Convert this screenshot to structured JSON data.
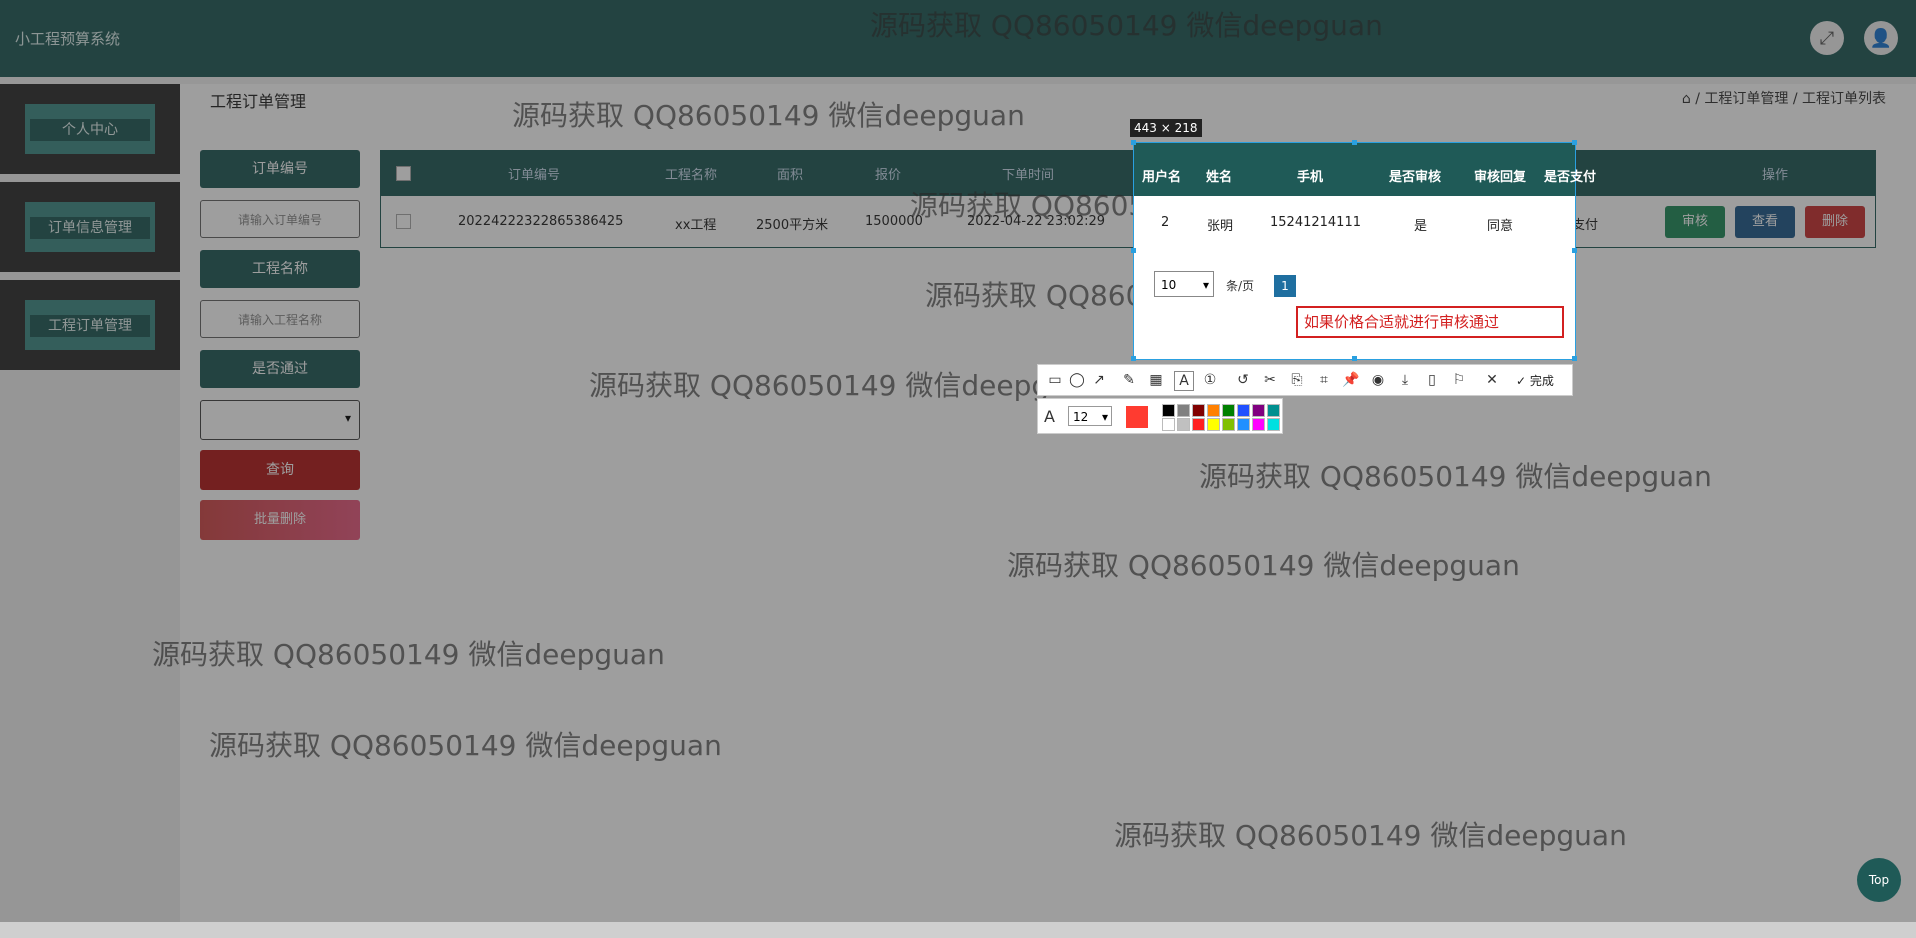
{
  "app": {
    "title": "小工程预算系统"
  },
  "sidebar": {
    "items": [
      {
        "label": "个人中心"
      },
      {
        "label": "订单信息管理"
      },
      {
        "label": "工程订单管理"
      }
    ]
  },
  "page": {
    "title": "工程订单管理",
    "breadcrumb": [
      "工程订单管理",
      "工程订单列表"
    ],
    "breadcrumb_sep": "/"
  },
  "filters": {
    "order_no_label": "订单编号",
    "order_no_placeholder": "请输入订单编号",
    "project_label": "工程名称",
    "project_placeholder": "请输入工程名称",
    "approved_label": "是否通过",
    "approved_value": "",
    "query_label": "查询",
    "bulk_delete_label": "批量删除"
  },
  "table": {
    "headers": [
      "订单编号",
      "工程名称",
      "面积",
      "报价",
      "下单时间",
      "用户名",
      "姓名",
      "手机",
      "是否审核",
      "审核回复",
      "是否支付",
      "操作"
    ],
    "rows": [
      {
        "order_no": "20224222322865386425",
        "project": "xx工程",
        "area": "2500平方米",
        "price": "1500000",
        "time": "2022-04-22 23:02:29",
        "user": "2",
        "name": "张明",
        "phone": "15241214111",
        "audited": "是",
        "reply": "同意",
        "paid": "已支付"
      }
    ],
    "actions": [
      "审核",
      "查看",
      "删除"
    ]
  },
  "pagination": {
    "page_size": "10",
    "total_label": "条/页",
    "current_page": "1"
  },
  "capture": {
    "size_label": "443 × 218",
    "annotation_text": "如果价格合适就进行审核通过",
    "font_size": "12",
    "done_label": "完成",
    "current_color": "#ff3b30",
    "swatches": [
      "#000000",
      "#808080",
      "#800000",
      "#ff8000",
      "#008000",
      "#2050ff",
      "#800080",
      "#009090",
      "#ffffff",
      "#c0c0c0",
      "#ff2020",
      "#ffff00",
      "#80c000",
      "#2090ff",
      "#ff00ff",
      "#00e0e0"
    ]
  },
  "watermark": "源码获取 QQ86050149 微信deepguan",
  "top_button": "Top"
}
